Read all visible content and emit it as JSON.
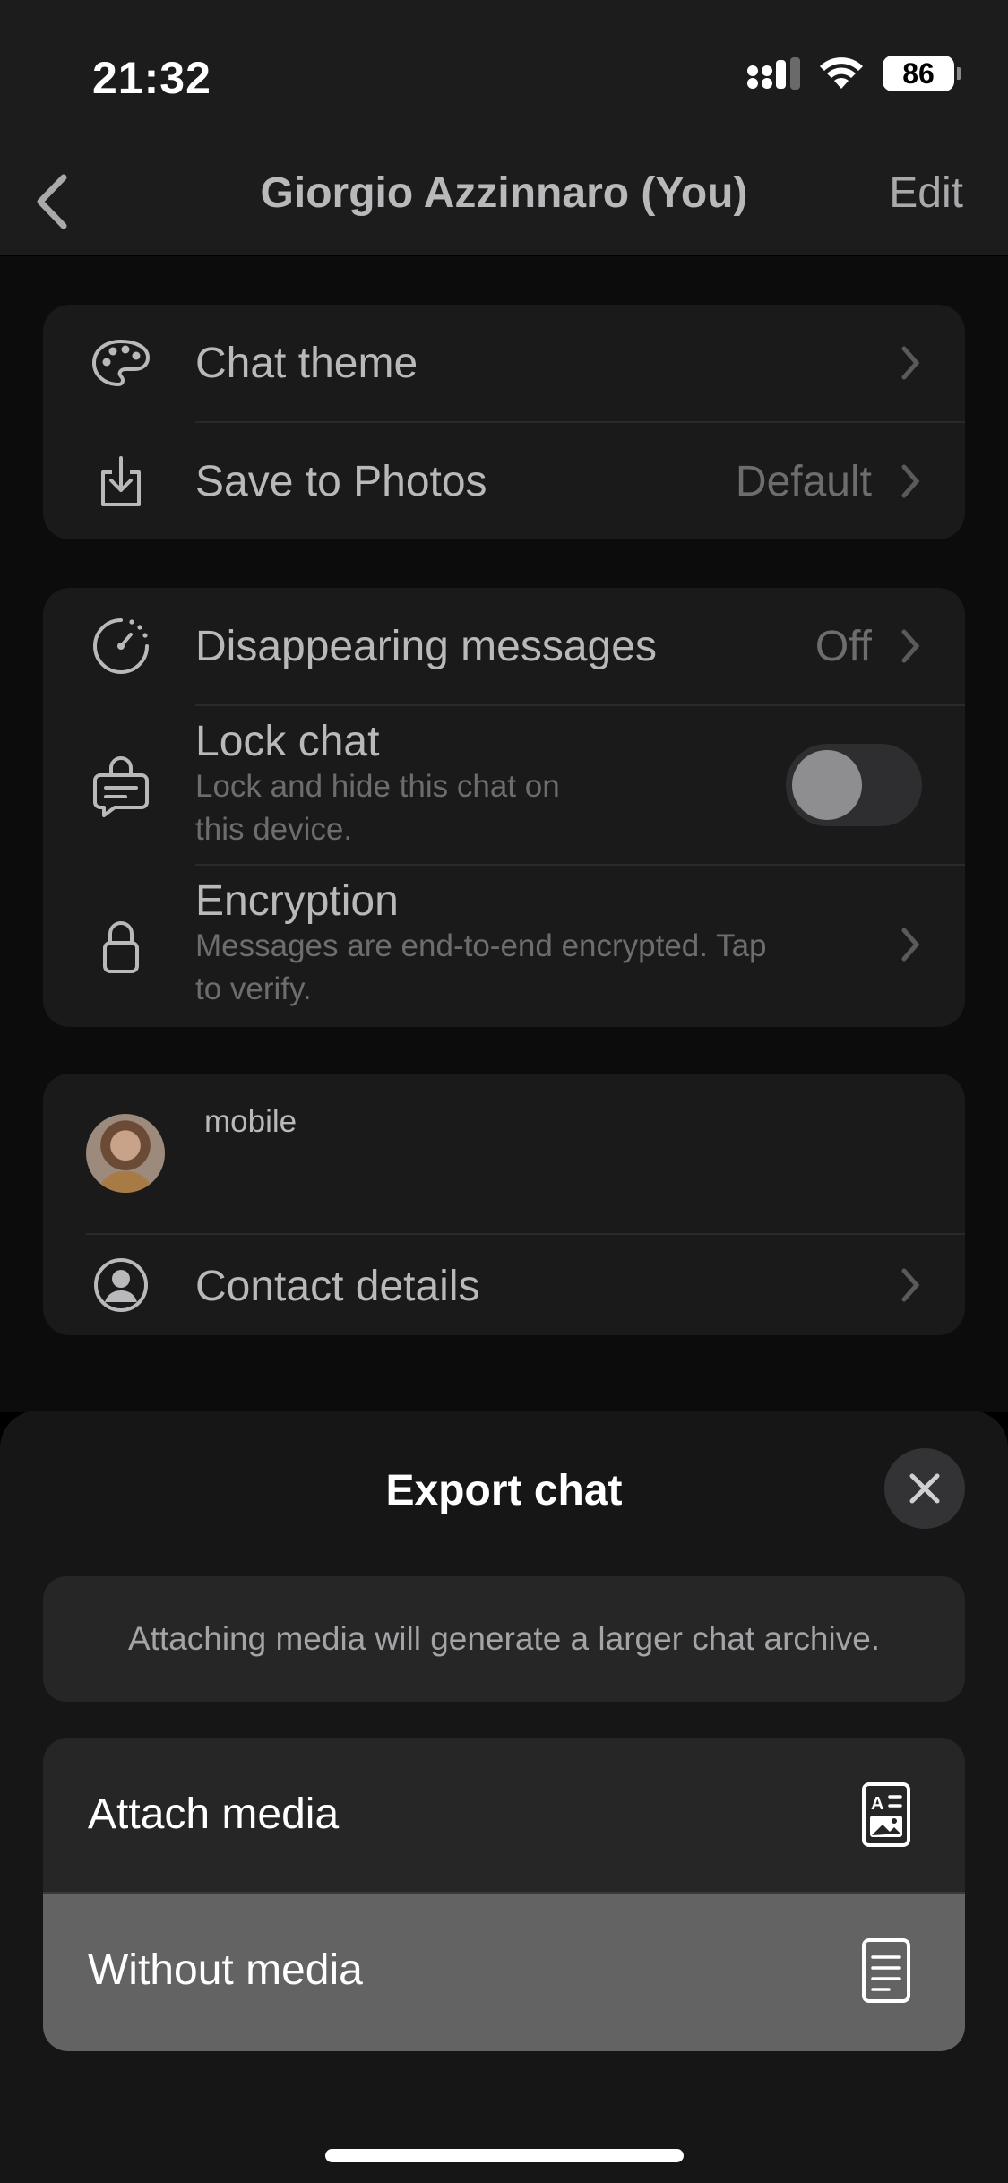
{
  "status_bar": {
    "time": "21:32",
    "battery": "86"
  },
  "nav": {
    "title": "Giorgio Azzinnaro (You)",
    "edit_label": "Edit"
  },
  "settings_group_1": {
    "chat_theme": "Chat theme",
    "save_to_photos": "Save to Photos",
    "save_to_photos_value": "Default"
  },
  "settings_group_2": {
    "disappearing_messages": "Disappearing messages",
    "disappearing_messages_value": "Off",
    "lock_chat": "Lock chat",
    "lock_chat_sub_1": "Lock and hide this chat on",
    "lock_chat_sub_2": "this device.",
    "lock_chat_enabled": false,
    "encryption": "Encryption",
    "encryption_sub_1": "Messages are end-to-end encrypted. Tap",
    "encryption_sub_2": "to verify."
  },
  "contact_group": {
    "phone_label": "mobile",
    "contact_details": "Contact details"
  },
  "export_sheet": {
    "title": "Export chat",
    "info": "Attaching media will generate a larger chat archive.",
    "options": [
      {
        "label": "Attach media",
        "icon": "document-with-media-icon",
        "selected": false
      },
      {
        "label": "Without media",
        "icon": "document-text-icon",
        "selected": true
      }
    ]
  },
  "colors": {
    "sheet_bg": "#161617",
    "option_bg": "#262627",
    "option_selected_bg": "#636364"
  }
}
